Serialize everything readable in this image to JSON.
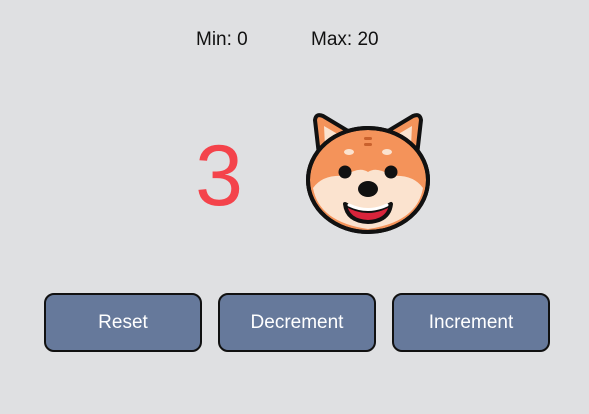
{
  "limits": {
    "min_label": "Min: 0",
    "max_label": "Max: 20"
  },
  "counter": {
    "value": "3",
    "color": "#f4434b"
  },
  "mascot": {
    "icon": "shiba-dog-face-icon"
  },
  "buttons": {
    "reset_label": "Reset",
    "decrement_label": "Decrement",
    "increment_label": "Increment"
  },
  "colors": {
    "background": "#dfe0e2",
    "button_fill": "#66799b",
    "button_text": "#ffffff"
  }
}
